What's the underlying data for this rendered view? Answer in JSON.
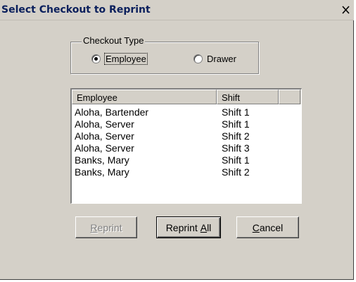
{
  "window": {
    "title": "Select Checkout to Reprint",
    "close_glyph": "X"
  },
  "checkout_type": {
    "legend": "Checkout Type",
    "options": [
      {
        "label": "Employee",
        "checked": true
      },
      {
        "label": "Drawer",
        "checked": false
      }
    ]
  },
  "list": {
    "columns": [
      "Employee",
      "Shift",
      ""
    ],
    "rows": [
      {
        "employee": "Aloha, Bartender",
        "shift": "Shift 1"
      },
      {
        "employee": "Aloha, Server",
        "shift": "Shift 1"
      },
      {
        "employee": "Aloha, Server",
        "shift": "Shift 2"
      },
      {
        "employee": "Aloha, Server",
        "shift": "Shift 3"
      },
      {
        "employee": "Banks, Mary",
        "shift": "Shift 1"
      },
      {
        "employee": "Banks, Mary",
        "shift": "Shift 2"
      }
    ]
  },
  "buttons": {
    "reprint": {
      "prefix": "",
      "accel": "R",
      "suffix": "eprint",
      "enabled": false
    },
    "reprint_all": {
      "prefix": "Reprint ",
      "accel": "A",
      "suffix": "ll",
      "enabled": true
    },
    "cancel": {
      "prefix": "",
      "accel": "C",
      "suffix": "ancel",
      "enabled": true
    }
  },
  "colors": {
    "face": "#d4d0c8",
    "title_text": "#0a1f5c",
    "disabled_text": "#808080"
  }
}
